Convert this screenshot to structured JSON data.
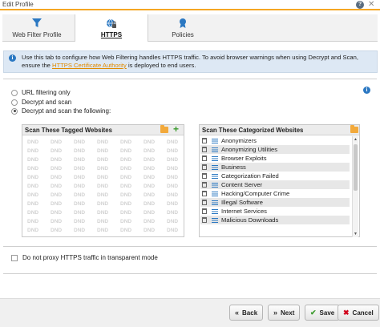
{
  "window": {
    "title": "Edit Profile",
    "help_icon": "help-icon",
    "close_glyph": "✕"
  },
  "tabs": [
    {
      "label": "Web Filter Profile",
      "icon": "filter-icon",
      "active": false
    },
    {
      "label": "HTTPS",
      "icon": "lock-globe-icon",
      "active": true
    },
    {
      "label": "Policies",
      "icon": "ribbon-icon",
      "active": false
    }
  ],
  "info": {
    "line1": "Use this tab to configure how Web Filtering handles HTTPS traffic. To avoid browser warnings when using Decrypt and Scan,",
    "line2_pre": "ensure the ",
    "link": "HTTPS Certificate Authority",
    "line2_post": " is deployed to end users."
  },
  "options": [
    {
      "label": "URL filtering only",
      "selected": false
    },
    {
      "label": "Decrypt and scan",
      "selected": false
    },
    {
      "label": "Decrypt and scan the following:",
      "selected": true
    }
  ],
  "tagged": {
    "header": "Scan These Tagged Websites",
    "placeholder": "DND"
  },
  "categorized": {
    "header": "Scan These Categorized Websites",
    "items": [
      "Anonymizers",
      "Anonymizing Utilities",
      "Browser Exploits",
      "Business",
      "Categorization Failed",
      "Content Server",
      "Hacking/Computer Crime",
      "Illegal Software",
      "Internet Services",
      "Malicious Downloads"
    ]
  },
  "transparent_proxy": {
    "label": "Do not proxy HTTPS traffic in transparent mode",
    "checked": false
  },
  "buttons": {
    "back": "Back",
    "next": "Next",
    "save": "Save",
    "cancel": "Cancel"
  },
  "colors": {
    "accent": "#f5a623",
    "link": "#e08a00",
    "info_bg": "#dde8f4",
    "save_icon": "#3a9a2c",
    "cancel_icon": "#d0021b"
  }
}
